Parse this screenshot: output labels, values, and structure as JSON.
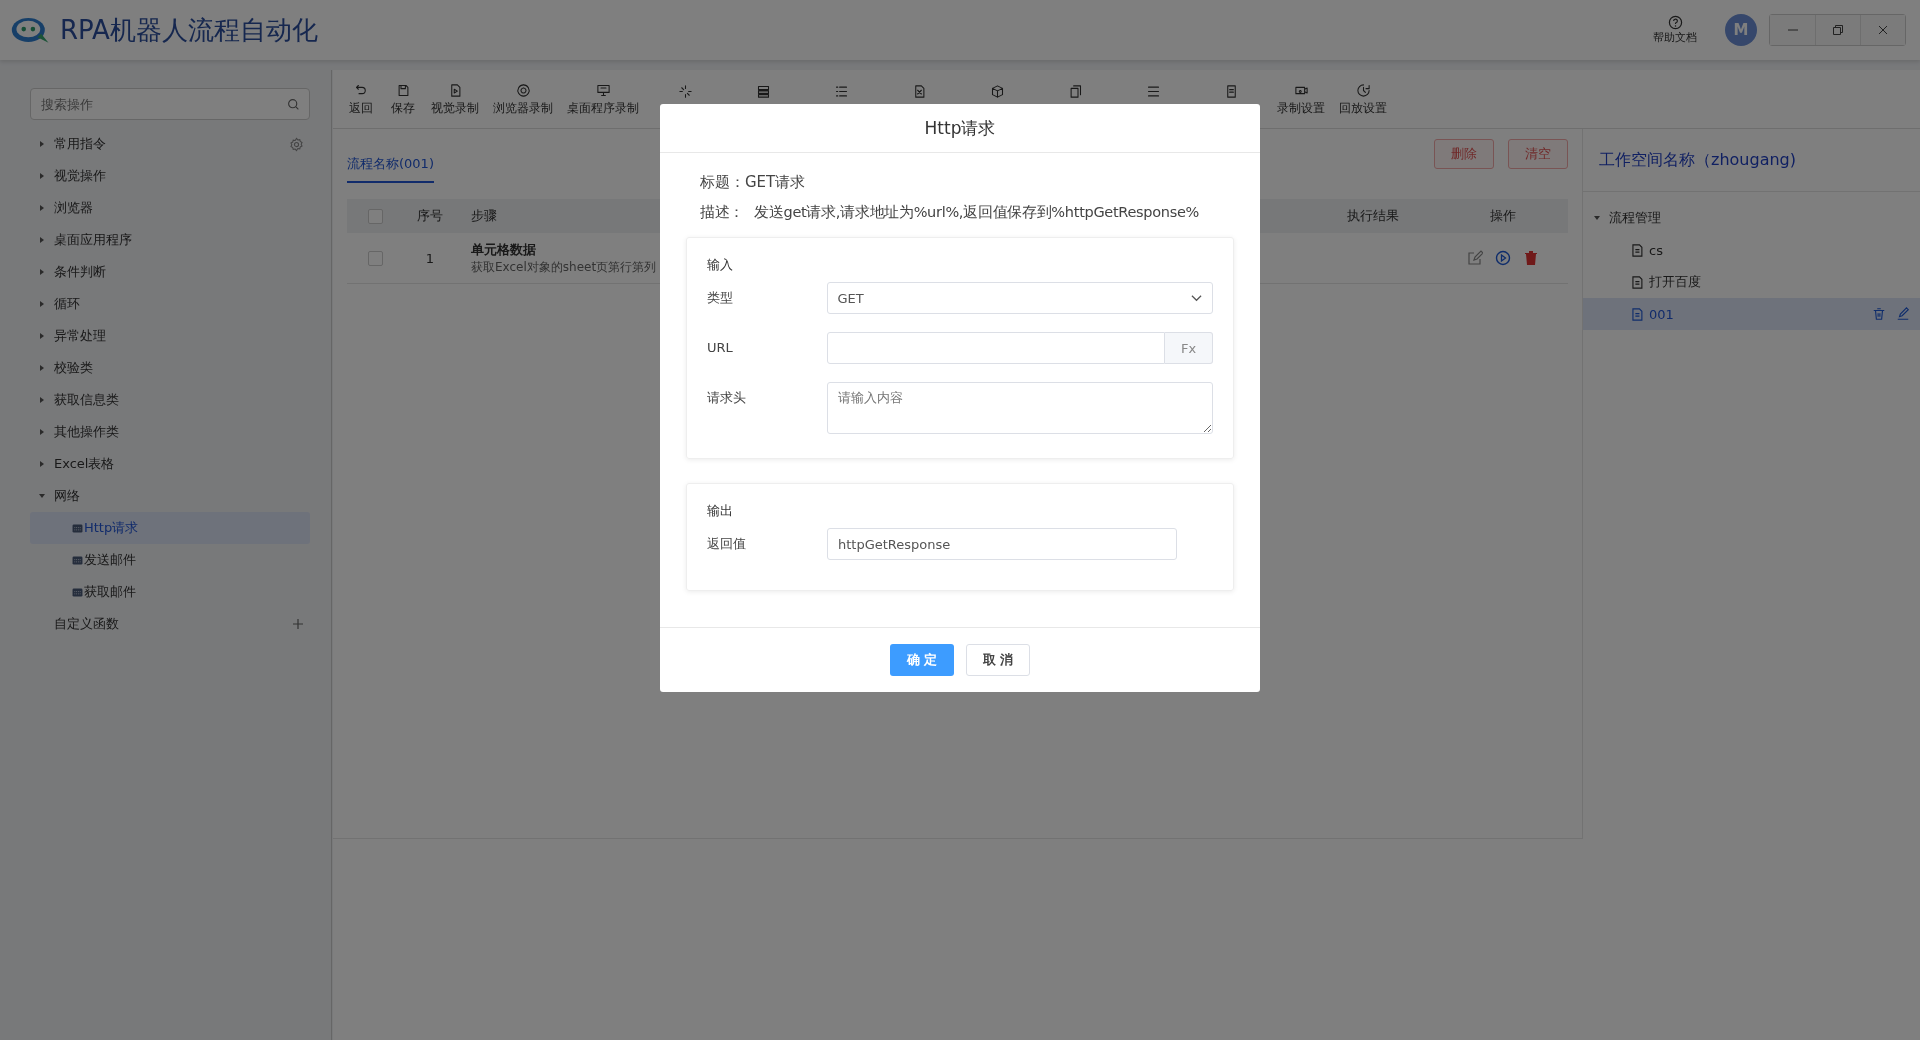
{
  "app": {
    "title": "RPA机器人流程自动化",
    "help": "帮助文档",
    "avatar": "M"
  },
  "sidebar": {
    "search_placeholder": "搜索操作",
    "categories": [
      {
        "label": "常用指令",
        "expanded": false,
        "settings": true
      },
      {
        "label": "视觉操作",
        "expanded": false
      },
      {
        "label": "浏览器",
        "expanded": false
      },
      {
        "label": "桌面应用程序",
        "expanded": false
      },
      {
        "label": "条件判断",
        "expanded": false
      },
      {
        "label": "循环",
        "expanded": false
      },
      {
        "label": "异常处理",
        "expanded": false
      },
      {
        "label": "校验类",
        "expanded": false
      },
      {
        "label": "获取信息类",
        "expanded": false
      },
      {
        "label": "其他操作类",
        "expanded": false
      },
      {
        "label": "Excel表格",
        "expanded": false
      },
      {
        "label": "网络",
        "expanded": true,
        "children": [
          {
            "label": "Http请求",
            "selected": true
          },
          {
            "label": "发送邮件",
            "selected": false
          },
          {
            "label": "获取邮件",
            "selected": false
          }
        ]
      }
    ],
    "custom_functions": "自定义函数"
  },
  "toolbar": [
    {
      "kind": "labeled",
      "label": "返回"
    },
    {
      "kind": "labeled",
      "label": "保存"
    },
    {
      "kind": "labeled",
      "label": "视觉录制"
    },
    {
      "kind": "labeled",
      "label": "浏览器录制"
    },
    {
      "kind": "labeled",
      "label": "桌面程序录制"
    },
    {
      "kind": "icon_only"
    },
    {
      "kind": "icon_only"
    },
    {
      "kind": "icon_only"
    },
    {
      "kind": "icon_only"
    },
    {
      "kind": "icon_only"
    },
    {
      "kind": "icon_only"
    },
    {
      "kind": "icon_only"
    },
    {
      "kind": "icon_only"
    },
    {
      "kind": "labeled",
      "label": "录制设置"
    },
    {
      "kind": "labeled",
      "label": "回放设置"
    }
  ],
  "tab": {
    "label": "流程名称(001)",
    "selected": true
  },
  "actions": [
    "删除",
    "清空"
  ],
  "table": {
    "all_checked": false,
    "columns": [
      "序号",
      "步骤",
      "执行结果",
      "操作"
    ],
    "rows": [
      {
        "checked": false,
        "index": "1",
        "title": "单元格数据",
        "description": "获取Excel对象的sheet页第行第列"
      }
    ]
  },
  "workspace": {
    "title": "工作空间名称（zhougang)",
    "tree": {
      "label": "流程管理",
      "expanded": true,
      "children": [
        {
          "label": "cs",
          "selected": false
        },
        {
          "label": "打开百度",
          "selected": false
        },
        {
          "label": "001",
          "selected": true
        }
      ]
    }
  },
  "dialog": {
    "title": "Http请求",
    "heading_label": "标题：",
    "heading": "GET请求",
    "description_label": "描述：",
    "description": "发送get请求,请求地址为%url%,返回值保存到%httpGetResponse%",
    "input_section": {
      "title": "输入",
      "fields": [
        {
          "kind": "select",
          "label": "类型",
          "value": "GET"
        },
        {
          "kind": "fx",
          "label": "URL",
          "fx": "Fx"
        },
        {
          "kind": "textarea",
          "label": "请求头",
          "placeholder": "请输入内容"
        }
      ]
    },
    "output_section": {
      "title": "输出",
      "fields": [
        {
          "kind": "text",
          "label": "返回值",
          "value": "httpGetResponse"
        }
      ]
    },
    "buttons": [
      {
        "kind": "primary",
        "label": "确 定"
      },
      {
        "kind": "default",
        "label": "取 消"
      }
    ]
  }
}
